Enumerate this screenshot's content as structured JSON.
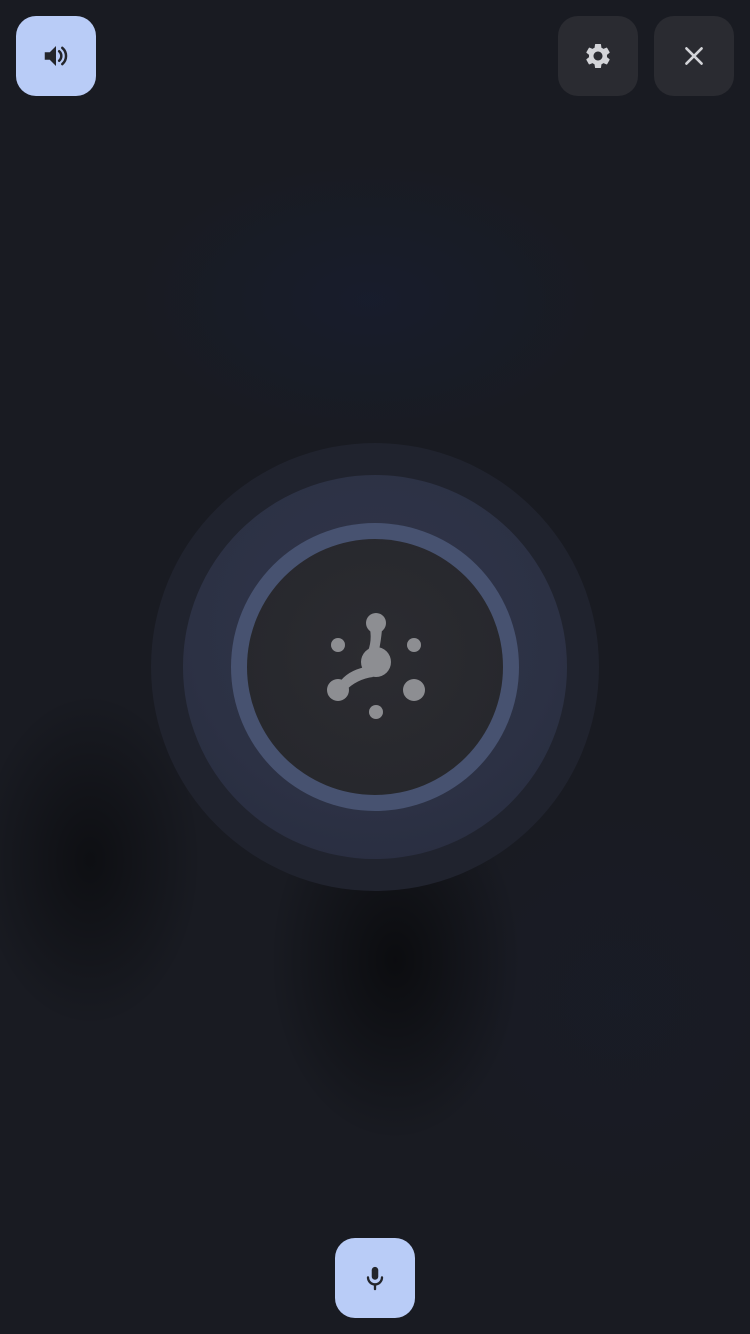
{
  "controls": {
    "speaker": {
      "icon": "speaker-icon"
    },
    "settings": {
      "icon": "gear-icon"
    },
    "close": {
      "icon": "close-icon"
    },
    "microphone": {
      "icon": "microphone-icon"
    }
  },
  "orb": {
    "icon": "molecule-logo-icon"
  },
  "colors": {
    "background": "#191b22",
    "accent_button": "#b9ccf7",
    "dark_button": "#2a2b31",
    "ring": "#475270",
    "orb_core": "#27282d",
    "icon_light": "#2b2d33",
    "icon_muted": "#8d8e92"
  }
}
